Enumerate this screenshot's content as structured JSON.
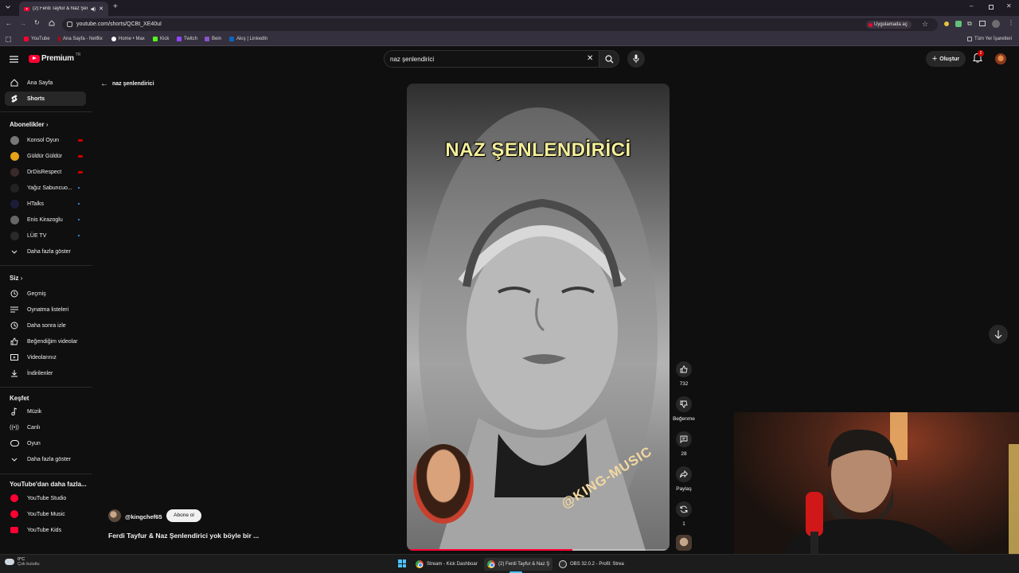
{
  "browser": {
    "tab_title": "(2) Ferdi Tayfur & Naz Şenl",
    "url": "youtube.com/shorts/QCBt_XE40uI",
    "open_in_app": "Uygulamada aç",
    "bookmarks": [
      "YouTube",
      "Ana Sayfa - Netflix",
      "Home • Max",
      "Kick",
      "Twitch",
      "Bein",
      "Akış | LinkedIn"
    ],
    "all_bookmarks": "Tüm Yer İşaretleri"
  },
  "yt": {
    "logo_text": "Premium",
    "logo_region": "TR",
    "search_value": "naz şenlendirici",
    "create_label": "Oluştur",
    "notif_count": "2",
    "back_label": "naz şenlendirici"
  },
  "sidebar": {
    "home": "Ana Sayfa",
    "shorts": "Shorts",
    "subs_title": "Abonelikler",
    "subs": [
      "Konsol Oyun",
      "Güldür Güldür",
      "DrDisRespect",
      "Yağız Sabuncuo...",
      "HTalks",
      "Enis Kirazoglu",
      "LÜE TV"
    ],
    "show_more": "Daha fazla göster",
    "you_title": "Siz",
    "you_items": [
      "Geçmiş",
      "Oynatma listeleri",
      "Daha sonra izle",
      "Beğendiğim videolar",
      "Videolarınız",
      "İndirilenler"
    ],
    "explore_title": "Keşfet",
    "explore_items": [
      "Müzik",
      "Canlı",
      "Oyun"
    ],
    "explore_more": "Daha fazla göster",
    "more_title": "YouTube'dan daha fazla...",
    "more_items": [
      "YouTube Studio",
      "YouTube Music",
      "YouTube Kids"
    ]
  },
  "video": {
    "overlay_title": "NAZ ŞENLENDİRİCİ",
    "watermark": "@KING-MUSIC",
    "channel": "@kingchef65",
    "subscribe": "Abone ol",
    "title": "Ferdi Tayfur & Naz Şenlendirici yok böyle bir ...",
    "progress": 0.63
  },
  "actions": {
    "likes": "732",
    "dislike": "Beğenme",
    "comments": "28",
    "share": "Paylaş",
    "remix": "1"
  },
  "taskbar": {
    "weather_temp": "0°C",
    "weather_desc": "Çok bulutlu",
    "apps": [
      "Stream - Kick Dashboar",
      "(2) Ferdi Tayfur & Naz Ş",
      "OBS 32.0.2 - Profil: Strea"
    ]
  }
}
